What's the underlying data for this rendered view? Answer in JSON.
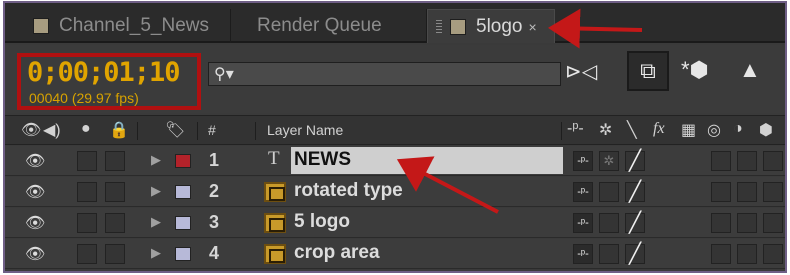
{
  "tabs": [
    {
      "label": "Channel_5_News",
      "active": false
    },
    {
      "label": "Render Queue",
      "active": false
    },
    {
      "label": "5logo",
      "active": true
    }
  ],
  "timecode": {
    "value": "0;00;01;10",
    "frames": "00040 (29.97 fps)"
  },
  "search": {
    "placeholder": "",
    "icon": "search-icon"
  },
  "columns": {
    "layer_name": "Layer Name",
    "number": "#"
  },
  "layers": [
    {
      "number": "1",
      "name": "NEWS",
      "type": "text",
      "label_color": "#b3222a",
      "selected": true
    },
    {
      "number": "2",
      "name": "rotated type",
      "type": "comp",
      "label_color": "#b7b9d8",
      "selected": false
    },
    {
      "number": "3",
      "name": "5 logo",
      "type": "comp",
      "label_color": "#b7b9d8",
      "selected": false
    },
    {
      "number": "4",
      "name": "crop area",
      "type": "comp",
      "label_color": "#b7b9d8",
      "selected": false
    }
  ],
  "colors": {
    "accent_red": "#c41818",
    "timecode": "#e0a400",
    "panel": "#3b3b3b"
  }
}
